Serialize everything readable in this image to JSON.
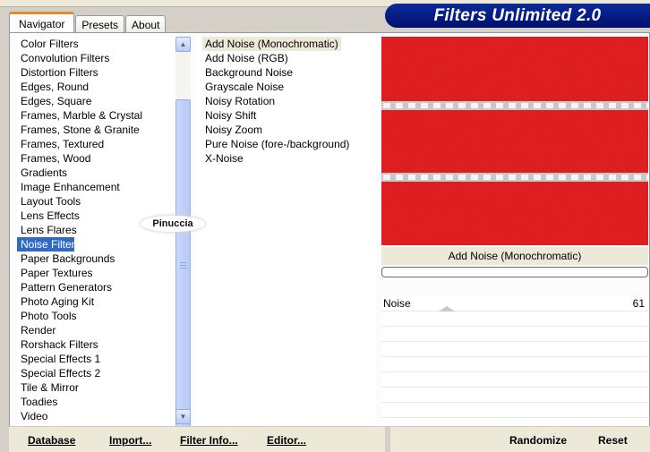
{
  "app": {
    "title": "Filters Unlimited 2.0"
  },
  "tabs": [
    {
      "label": "Navigator",
      "active": true
    },
    {
      "label": "Presets",
      "active": false
    },
    {
      "label": "About",
      "active": false
    }
  ],
  "categories": [
    "Color Filters",
    "Convolution Filters",
    "Distortion Filters",
    "Edges, Round",
    "Edges, Square",
    "Frames, Marble & Crystal",
    "Frames, Stone & Granite",
    "Frames, Textured",
    "Frames, Wood",
    "Gradients",
    "Image Enhancement",
    "Layout Tools",
    "Lens Effects",
    "Lens Flares",
    "Noise Filters",
    "Paper Backgrounds",
    "Paper Textures",
    "Pattern Generators",
    "Photo Aging Kit",
    "Photo Tools",
    "Render",
    "Rorshack Filters",
    "Special Effects 1",
    "Special Effects 2",
    "Tile & Mirror",
    "Toadies",
    "Video"
  ],
  "selected_category": "Noise Filters",
  "filters": [
    "Add Noise (Monochromatic)",
    "Add Noise (RGB)",
    "Background Noise",
    "Grayscale Noise",
    "Noisy Rotation",
    "Noisy Shift",
    "Noisy Zoom",
    "Pure Noise (fore-/background)",
    "X-Noise"
  ],
  "selected_filter": "Add Noise (Monochromatic)",
  "watermark": "Pinuccia",
  "preview": {
    "filter_name": "Add Noise (Monochromatic)",
    "base_color": "#d8191c",
    "progress": 0.0
  },
  "params": [
    {
      "label": "Noise",
      "value": "61",
      "fraction": 0.245
    }
  ],
  "buttons": {
    "database": "Database",
    "import": "Import...",
    "filter_info": "Filter Info...",
    "editor": "Editor...",
    "randomize": "Randomize",
    "reset": "Reset"
  },
  "colors": {
    "banner": "#0b2a99",
    "selection": "#316ac5",
    "preview_red": "#d8191c"
  }
}
